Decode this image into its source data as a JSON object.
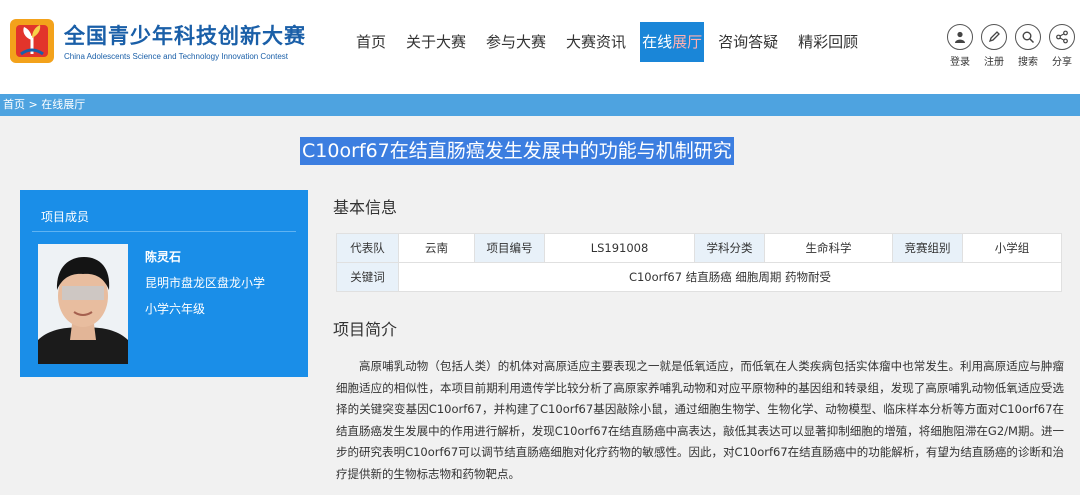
{
  "header": {
    "logo_cn": "全国青少年科技创新大赛",
    "logo_en": "China Adolescents Science and Technology Innovation Contest",
    "nav": [
      {
        "label": "首页",
        "active": false
      },
      {
        "label": "关于大赛",
        "active": false
      },
      {
        "label": "参与大赛",
        "active": false
      },
      {
        "label": "大赛资讯",
        "active": false
      },
      {
        "label_a": "在线",
        "label_b": "展厅",
        "active": true
      },
      {
        "label": "咨询答疑",
        "active": false
      },
      {
        "label": "精彩回顾",
        "active": false
      }
    ],
    "tools": [
      {
        "label": "登录",
        "icon": "user-icon"
      },
      {
        "label": "注册",
        "icon": "pencil-icon"
      },
      {
        "label": "搜索",
        "icon": "search-icon"
      },
      {
        "label": "分享",
        "icon": "share-icon"
      }
    ]
  },
  "breadcrumb": "首页 > 在线展厅",
  "project": {
    "title": "C10orf67在结直肠癌发生发展中的功能与机制研究",
    "members_heading": "项目成员",
    "member": {
      "name": "陈灵石",
      "school": "昆明市盘龙区盘龙小学",
      "grade": "小学六年级"
    },
    "basic_heading": "基本信息",
    "info": {
      "team_label": "代表队",
      "team": "云南",
      "id_label": "项目编号",
      "id": "LS191008",
      "subject_label": "学科分类",
      "subject": "生命科学",
      "group_label": "竞赛组别",
      "group": "小学组",
      "keywords_label": "关键词",
      "keywords": "C10orf67 结直肠癌 细胞周期 药物耐受"
    },
    "intro_heading": "项目简介",
    "intro": "高原哺乳动物（包括人类）的机体对高原适应主要表现之一就是低氧适应，而低氧在人类疾病包括实体瘤中也常发生。利用高原适应与肿瘤细胞适应的相似性，本项目前期利用遗传学比较分析了高原家养哺乳动物和对应平原物种的基因组和转录组，发现了高原哺乳动物低氧适应受选择的关键突变基因C10orf67，并构建了C10orf67基因敲除小鼠，通过细胞生物学、生物化学、动物模型、临床样本分析等方面对C10orf67在结直肠癌发生发展中的作用进行解析，发现C10orf67在结直肠癌中高表达，敲低其表达可以显著抑制细胞的增殖，将细胞阻滞在G2/M期。进一步的研究表明C10orf67可以调节结直肠癌细胞对化疗药物的敏感性。因此，对C10orf67在结直肠癌中的功能解析，有望为结直肠癌的诊断和治疗提供新的生物标志物和药物靶点。"
  },
  "colors": {
    "brand_blue": "#1a5fa8",
    "nav_active": "#1a86d8",
    "breadcrumb_bar": "#4ea3e0",
    "member_card": "#1a8ee8",
    "title_highlight": "#3c7ee0"
  }
}
